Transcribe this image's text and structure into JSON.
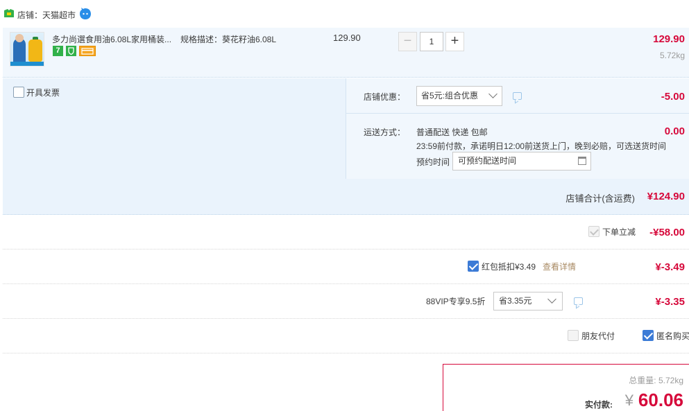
{
  "shop": {
    "label": "店铺：天猫超市"
  },
  "item": {
    "title": "多力尚選食用油6.08L家用桶装...",
    "spec": "规格描述：葵花籽油6.08L",
    "unit_price": "129.90",
    "quantity": "1",
    "subtotal": "129.90",
    "weight": "5.72kg",
    "badges": [
      "7",
      "shield",
      "card"
    ]
  },
  "options": {
    "invoice_label": "开具发票",
    "coupon_label": "店铺优惠：",
    "coupon_selected": "省5元:组合优惠",
    "coupon_value": "-5.00",
    "shipping_label": "运送方式：",
    "shipping_line1": "普通配送 快递 包邮",
    "shipping_line2": "23:59前付款，承诺明日12:00前送货上门，晚到必赔，可选送货时间",
    "appointment_label": "预约时间",
    "appointment_placeholder": "可预约配送时间",
    "shipping_value": "0.00"
  },
  "shop_total": {
    "label": "店铺合计(含运费)",
    "value": "¥124.90"
  },
  "discount_rows": {
    "instant": {
      "label": "下单立减",
      "value": "-¥58.00"
    },
    "redpacket": {
      "label": "红包抵扣¥3.49",
      "link": "查看详情",
      "value": "¥-3.49"
    },
    "vip": {
      "label": "88VIP专享9.5折",
      "selected": "省3.35元",
      "value": "¥-3.35"
    },
    "friend_pay": {
      "label": "朋友代付"
    },
    "anonymous": {
      "label": "匿名购买"
    }
  },
  "payment": {
    "weight_total": "总重量: 5.72kg",
    "pay_label": "实付款:",
    "currency": "¥",
    "pay_value": "60.06"
  },
  "colors": {
    "price_red": "#d6083a",
    "row_blue": "#f1f7fd",
    "accent_blue": "#3c7bd6"
  }
}
